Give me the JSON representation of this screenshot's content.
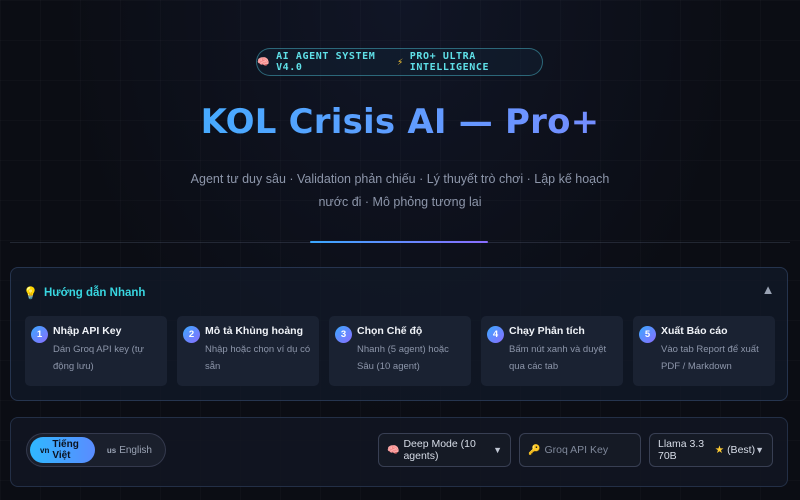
{
  "header": {
    "badge_label_1": "AI AGENT SYSTEM V4.0",
    "badge_label_2": "PRO+ ULTRA INTELLIGENCE",
    "title": "KOL Crisis AI — Pro+",
    "subtitle": "Agent tư duy sâu · Validation phản chiếu · Lý thuyết trò chơi · Lập kế hoạch nước đi · Mô phỏng tương lai"
  },
  "guide": {
    "title": "Hướng dẫn Nhanh",
    "collapse_symbol": "▲",
    "steps": [
      {
        "num": "1",
        "title": "Nhập API Key",
        "desc": "Dán Groq API key (tự động lưu)"
      },
      {
        "num": "2",
        "title": "Mô tả Khủng hoảng",
        "desc": "Nhập hoặc chọn ví dụ có sẵn"
      },
      {
        "num": "3",
        "title": "Chọn Chế độ",
        "desc": "Nhanh (5 agent) hoặc Sâu (10 agent)"
      },
      {
        "num": "4",
        "title": "Chạy Phân tích",
        "desc": "Bấm nút xanh và duyệt qua các tab"
      },
      {
        "num": "5",
        "title": "Xuất Báo cáo",
        "desc": "Vào tab Report để xuất PDF / Markdown"
      }
    ]
  },
  "controls": {
    "lang_vi_flag": "vn",
    "lang_vi": "Tiếng Việt",
    "lang_en_flag": "us",
    "lang_en": "English",
    "mode_selected": "Deep Mode (10 agents)",
    "api_placeholder": "Groq API Key",
    "model_selected": "Llama 3.3 70B",
    "model_suffix": "(Best)"
  },
  "icons": {
    "badge_left": "brain-icon",
    "badge_mid": "lightning-icon",
    "guide": "lightbulb-icon",
    "mode": "brain-icon",
    "api": "key-icon",
    "model": "star-icon"
  },
  "colors": {
    "accent_cyan": "#38d6e0",
    "accent_blue": "#2fb8ff",
    "accent_violet": "#8a6dff",
    "background": "#0b0d14"
  }
}
